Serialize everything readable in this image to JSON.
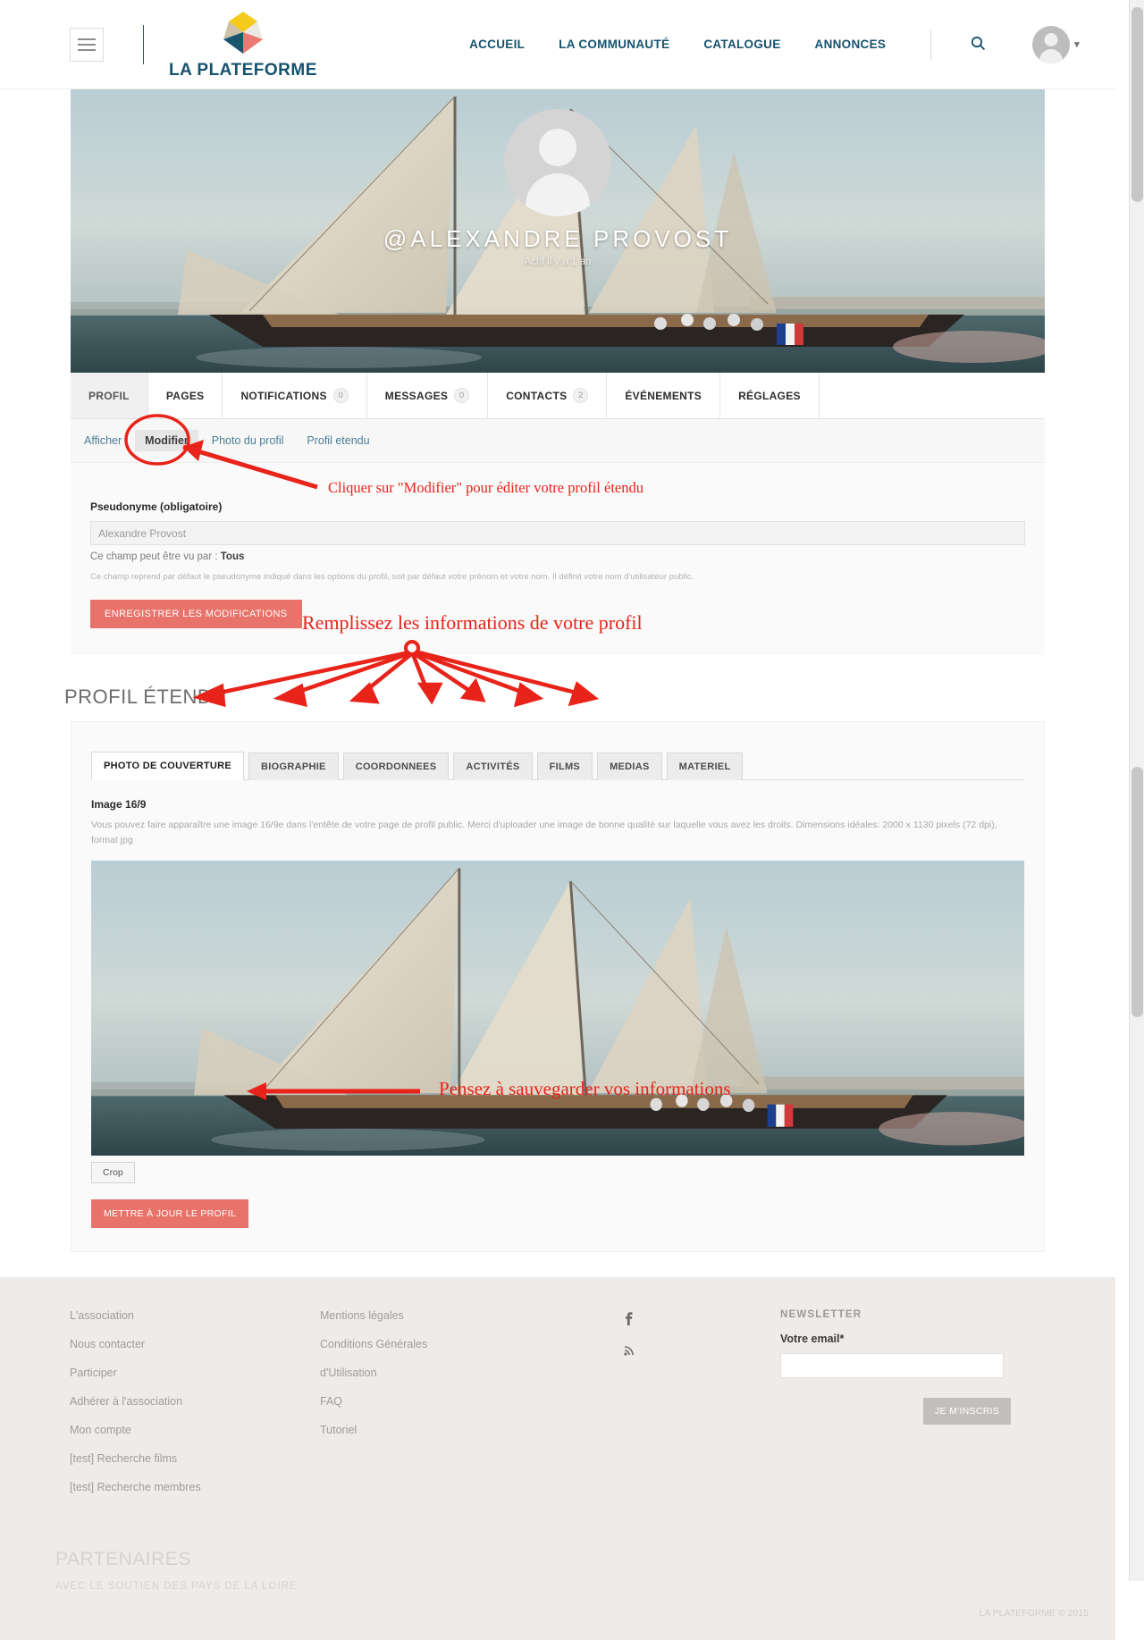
{
  "header": {
    "brand_name": "LA PLATEFORME",
    "menu_icon": "hamburger-icon",
    "search_icon": "search-icon",
    "nav": [
      {
        "label": "ACCUEIL"
      },
      {
        "label": "LA COMMUNAUTÉ"
      },
      {
        "label": "CATALOGUE"
      },
      {
        "label": "ANNONCES"
      }
    ],
    "account_caret": "▾"
  },
  "cover": {
    "handle": "@ALEXANDRE PROVOST",
    "subtitle": "Actif il y a 1 an"
  },
  "profile_tabs": [
    {
      "label": "PROFIL",
      "count": null,
      "active": true
    },
    {
      "label": "PAGES",
      "count": null,
      "active": false
    },
    {
      "label": "NOTIFICATIONS",
      "count": "0",
      "active": false
    },
    {
      "label": "MESSAGES",
      "count": "0",
      "active": false
    },
    {
      "label": "CONTACTS",
      "count": "2",
      "active": false
    },
    {
      "label": "ÉVÉNEMENTS",
      "count": null,
      "active": false
    },
    {
      "label": "RÉGLAGES",
      "count": null,
      "active": false
    }
  ],
  "subnav": [
    {
      "label": "Afficher",
      "selected": false
    },
    {
      "label": "Modifier",
      "selected": true
    },
    {
      "label": "Photo du profil",
      "selected": false
    },
    {
      "label": "Profil etendu",
      "selected": false
    }
  ],
  "edit_form": {
    "field_label": "Pseudonyme (obligatoire)",
    "field_value": "Alexandre Provost",
    "visibility_prefix": "Ce champ peut être vu par : ",
    "visibility_value": "Tous",
    "helper_text": "Ce champ reprend par défaut le pseudonyme indiqué dans les options du profil, soit par défaut votre prénom et votre nom. Il définit votre nom d'utilisateur public.",
    "save_label": "ENREGISTRER LES MODIFICATIONS"
  },
  "extended": {
    "section_title": "PROFIL ÉTENDU",
    "tabs": [
      {
        "label": "PHOTO DE COUVERTURE",
        "active": true
      },
      {
        "label": "BIOGRAPHIE",
        "active": false
      },
      {
        "label": "COORDONNEES",
        "active": false
      },
      {
        "label": "ACTIVITÉS",
        "active": false
      },
      {
        "label": "FILMS",
        "active": false
      },
      {
        "label": "MEDIAS",
        "active": false
      },
      {
        "label": "MATERIEL",
        "active": false
      }
    ],
    "image_heading": "Image 16/9",
    "image_description": "Vous pouvez faire apparaître une image 16/9e dans l'entête de votre page de profil public. Merci d'uploader une image de bonne qualité sur laquelle vous avez les droits. Dimensions idéales: 2000 x 1130 pixels (72 dpi), format jpg",
    "crop_label": "Crop",
    "update_label": "METTRE À JOUR LE PROFIL"
  },
  "annotations": [
    {
      "text": "Cliquer sur \"Modifier\" pour éditer votre profil étendu"
    },
    {
      "text": "Remplissez les informations de votre profil"
    },
    {
      "text": "Pensez à sauvegarder vos informations"
    }
  ],
  "footer": {
    "column1": [
      {
        "label": "L'association"
      },
      {
        "label": "Nous contacter"
      },
      {
        "label": "Participer"
      },
      {
        "label": "Adhérer à l'association"
      },
      {
        "label": "Mon compte"
      },
      {
        "label": "[test] Recherche films"
      },
      {
        "label": "[test] Recherche membres"
      }
    ],
    "column2": [
      {
        "label": "Mentions légales"
      },
      {
        "label": "Conditions Générales"
      },
      {
        "label": "d'Utilisation"
      },
      {
        "label": "FAQ"
      },
      {
        "label": "Tutoriel"
      }
    ],
    "social": [
      {
        "icon": "facebook-icon",
        "glyph": "f"
      },
      {
        "icon": "rss-icon",
        "glyph": "⌁"
      }
    ],
    "newsletter": {
      "title": "NEWSLETTER",
      "label": "Votre email*",
      "value": "",
      "button": "JE M'INSCRIS"
    },
    "partners_title": "PARTENAIRES",
    "partners_sub": "AVEC LE SOUTIEN DES PAYS DE LA LOIRE",
    "copyright": "LA PLATEFORME © 2015"
  },
  "colors": {
    "brand_blue": "#15526e",
    "accent_red": "#e8736a",
    "annotation_red": "#e8231a",
    "footer_bg": "#efebe8"
  }
}
